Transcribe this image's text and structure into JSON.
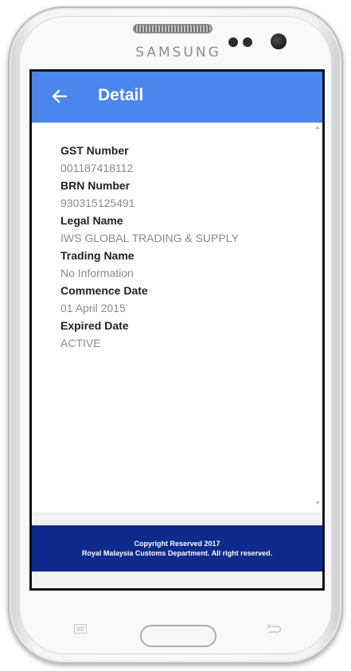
{
  "device": {
    "brand": "SAMSUNG"
  },
  "appbar": {
    "title": "Detail",
    "back_icon": "arrow-left-icon"
  },
  "fields": [
    {
      "label": "GST Number",
      "value": "001187418112"
    },
    {
      "label": "BRN Number",
      "value": "930315125491"
    },
    {
      "label": "Legal Name",
      "value": "IWS GLOBAL TRADING & SUPPLY"
    },
    {
      "label": "Trading Name",
      "value": "No Information"
    },
    {
      "label": "Commence Date",
      "value": "01 April 2015"
    },
    {
      "label": "Expired Date",
      "value": "ACTIVE"
    }
  ],
  "footer": {
    "line1": "Copyright Reserved 2017",
    "line2": "Royal Malaysia Customs Department. All right reserved."
  },
  "colors": {
    "appbar": "#4a86ec",
    "footer": "#0d2a8c",
    "label": "#222222",
    "value": "#8a8a8a"
  },
  "nav": {
    "menu_icon": "menu-icon",
    "home_icon": "home-button",
    "back_icon": "back-icon"
  }
}
